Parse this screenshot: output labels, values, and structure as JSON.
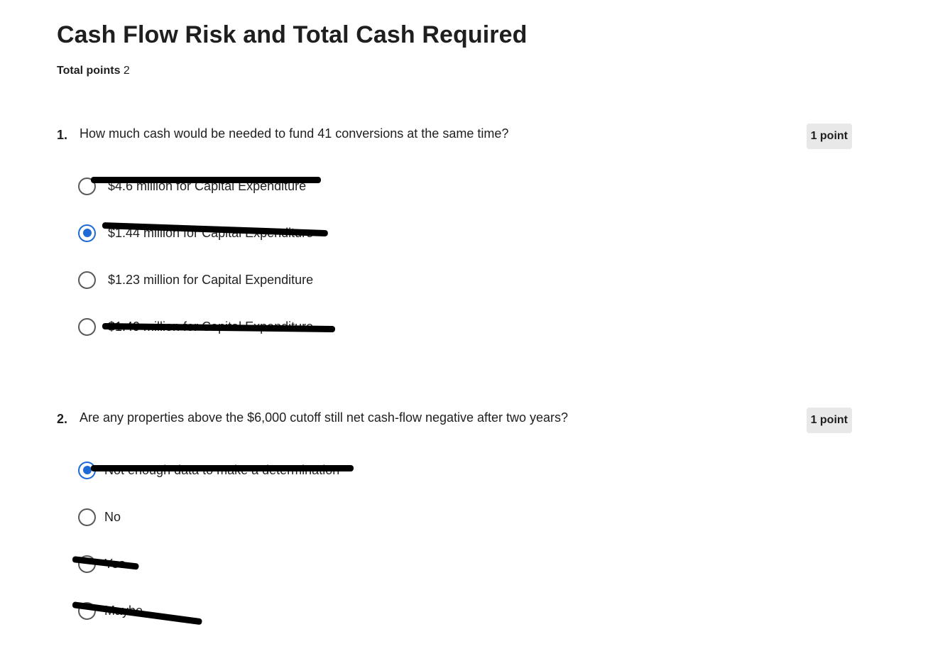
{
  "quiz": {
    "title": "Cash Flow Risk and Total Cash Required",
    "total_points_label": "Total points",
    "total_points_value": "2"
  },
  "questions": [
    {
      "number": "1.",
      "text": "How much cash would be needed to fund 41 conversions at the same time?",
      "points": "1 point",
      "options": [
        {
          "label": "$4.6 million for Capital Expenditure",
          "selected": false,
          "redacted": true
        },
        {
          "label": "$1.44 million for Capital Expenditure",
          "selected": true,
          "redacted": true
        },
        {
          "label": "$1.23 million for Capital Expenditure",
          "selected": false,
          "redacted": false
        },
        {
          "label": "$1.49 million for Capital Expenditure",
          "selected": false,
          "redacted": true
        }
      ]
    },
    {
      "number": "2.",
      "text": "Are any properties above the $6,000 cutoff still net cash-flow negative after two years?",
      "points": "1 point",
      "options": [
        {
          "label": "Not enough data to make a determination",
          "selected": true,
          "redacted": true
        },
        {
          "label": "No",
          "selected": false,
          "redacted": false
        },
        {
          "label": "Yes",
          "selected": false,
          "redacted": true
        },
        {
          "label": "Maybe",
          "selected": false,
          "redacted": true
        }
      ]
    }
  ],
  "colors": {
    "accent": "#1f6bd6",
    "badge_bg": "#e8e8e8",
    "text": "#1f1f1f",
    "redaction": "#000000"
  }
}
